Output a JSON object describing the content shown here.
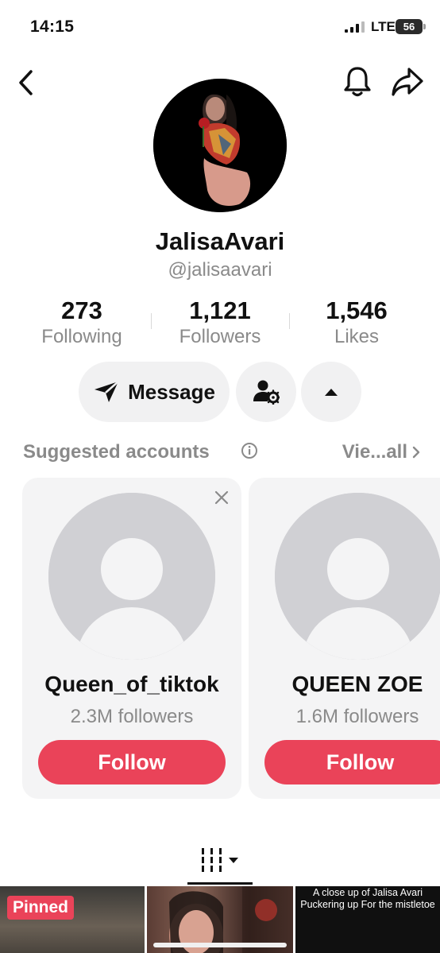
{
  "status_bar": {
    "time": "14:15",
    "network": "LTE",
    "battery": "56"
  },
  "profile": {
    "display_name": "JalisaAvari",
    "handle": "@jalisaavari",
    "stats": [
      {
        "value": "273",
        "label": "Following"
      },
      {
        "value": "1,121",
        "label": "Followers"
      },
      {
        "value": "1,546",
        "label": "Likes"
      }
    ]
  },
  "actions": {
    "message_label": "Message"
  },
  "suggested": {
    "title": "Suggested accounts",
    "view_all": "Vie...all",
    "cards": [
      {
        "name": "Queen_of_tiktok",
        "followers": "2.3M followers",
        "button": "Follow"
      },
      {
        "name": "QUEEN ZOE",
        "followers": "1.6M followers",
        "button": "Follow"
      }
    ]
  },
  "videos": {
    "pinned_label": "Pinned",
    "tile3_caption": "A close up of Jalisa Avari Puckering up For the mistletoe"
  },
  "colors": {
    "accent": "#ea4359",
    "muted_text": "#8a8a8a",
    "chip_bg": "#f1f1f2"
  }
}
